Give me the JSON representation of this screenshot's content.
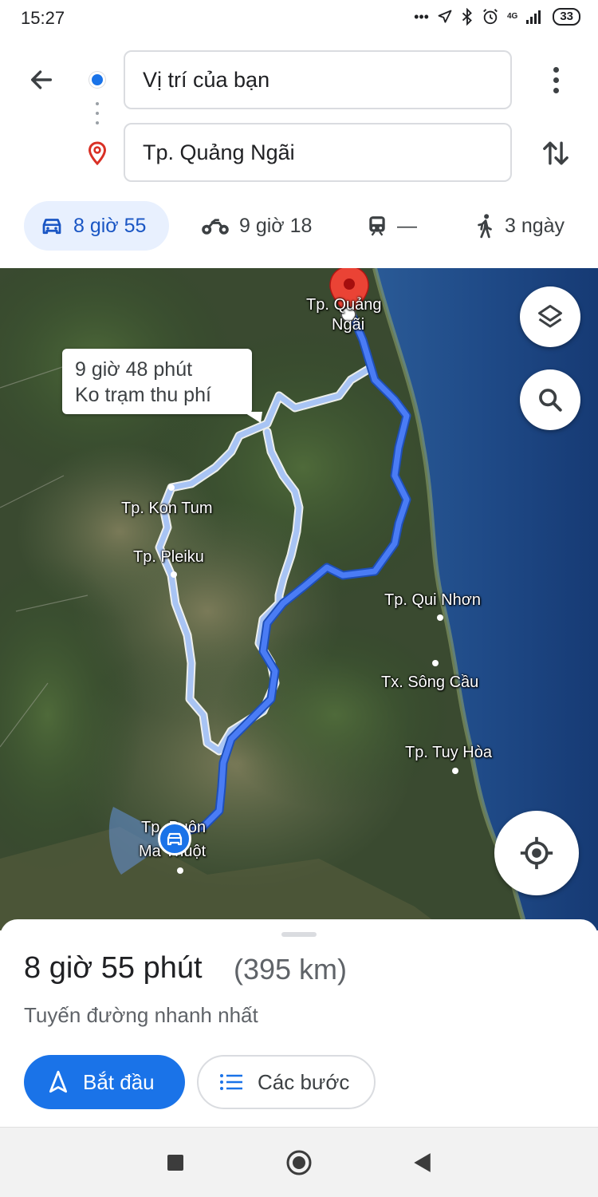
{
  "status": {
    "time": "15:27",
    "network": "4G",
    "battery": "33",
    "icons": [
      "more-dots-icon",
      "location-arrow-icon",
      "bluetooth-icon",
      "alarm-icon",
      "signal-icon",
      "battery-icon"
    ]
  },
  "directions": {
    "origin": "Vị trí của bạn",
    "destination": "Tp. Quảng Ngãi"
  },
  "modes": [
    {
      "name": "car",
      "label": "8 giờ 55",
      "active": true
    },
    {
      "name": "motorbike",
      "label": "9 giờ 18",
      "active": false
    },
    {
      "name": "transit",
      "label": "—",
      "active": false
    },
    {
      "name": "walk",
      "label": "3 ngày",
      "active": false
    }
  ],
  "map": {
    "callout": {
      "line1": "9 giờ 48 phút",
      "line2": "Ko trạm thu phí"
    },
    "labels": {
      "quang_ngai_1": "Tp. Quảng",
      "quang_ngai_2": "Ngãi",
      "kon_tum": "Tp. Kon Tum",
      "pleiku": "Tp. Pleiku",
      "qui_nhon": "Tp. Qui Nhơn",
      "song_cau": "Tx. Sông Cầu",
      "tuy_hoa": "Tp. Tuy Hòa",
      "buon_ma_thuot_1": "Tp. Buôn",
      "buon_ma_thuot_2": "Ma Thuột"
    },
    "colors": {
      "route_primary": "#4a7cf5",
      "route_alt": "#a8c4f4",
      "pin": "#ea4335"
    }
  },
  "sheet": {
    "duration": "8 giờ 55 phút",
    "distance": "(395 km)",
    "note": "Tuyến đường nhanh nhất",
    "start_label": "Bắt đầu",
    "steps_label": "Các bước"
  },
  "colors": {
    "accent": "#1a73e8",
    "active_mode_bg": "#e8f0fe"
  }
}
